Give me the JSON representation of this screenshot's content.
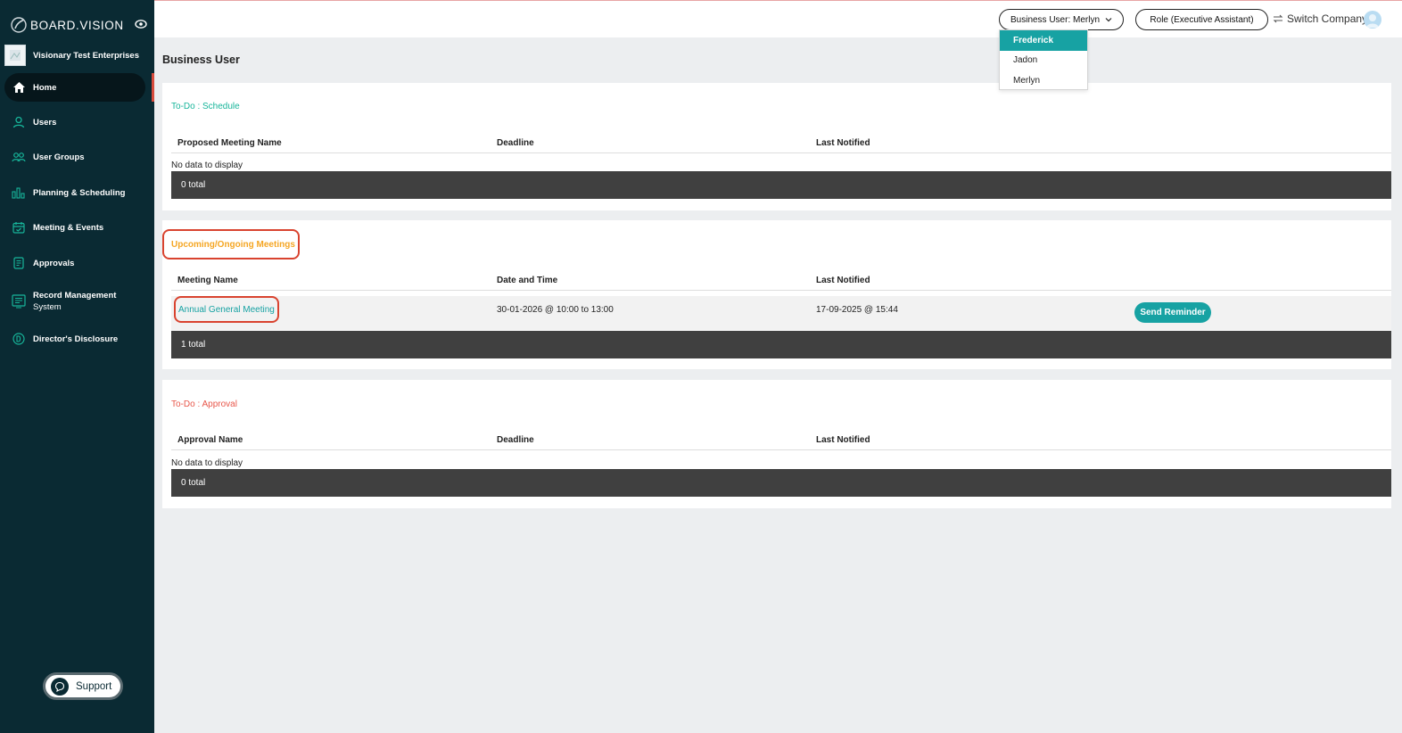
{
  "app": {
    "brand": "BOARD.VISION"
  },
  "sidebar": {
    "company": "Visionary Test Enterprises",
    "items": [
      {
        "label": "Home",
        "icon": "home-icon",
        "active": true
      },
      {
        "label": "Users",
        "icon": "user-icon"
      },
      {
        "label": "User Groups",
        "icon": "user-groups-icon"
      },
      {
        "label": "Planning & Scheduling",
        "icon": "bar-chart-icon"
      },
      {
        "label": "Meeting & Events",
        "icon": "calendar-icon"
      },
      {
        "label": "Approvals",
        "icon": "document-icon"
      },
      {
        "label_line1": "Record Management",
        "label_line2": "System",
        "icon": "records-icon"
      },
      {
        "label": "Director's Disclosure",
        "icon": "d-circle-icon"
      }
    ],
    "support_label": "Support"
  },
  "header": {
    "business_user": "Business User: Merlyn",
    "role": "Role (Executive Assistant)",
    "switch_company": "Switch Company",
    "dropdown_options": [
      "Frederick",
      "Jadon",
      "Merlyn"
    ],
    "dropdown_selected": "Frederick"
  },
  "page_title": "Business User",
  "schedule": {
    "title": "To-Do : Schedule",
    "columns": [
      "Proposed Meeting Name",
      "Deadline",
      "Last Notified"
    ],
    "empty_text": "No data to display",
    "total": "0 total"
  },
  "meetings": {
    "title": "Upcoming/Ongoing Meetings",
    "columns": [
      "Meeting Name",
      "Date and Time",
      "Last Notified"
    ],
    "rows": [
      {
        "name": "Annual General Meeting",
        "datetime": "30-01-2026 @ 10:00 to 13:00",
        "last_notified": "17-09-2025 @ 15:44",
        "action": "Send Reminder"
      }
    ],
    "total": "1 total"
  },
  "approval": {
    "title": "To-Do : Approval",
    "columns": [
      "Approval Name",
      "Deadline",
      "Last Notified"
    ],
    "empty_text": "No data to display",
    "total": "0 total"
  },
  "colors": {
    "sidebar_bg": "#0a2a33",
    "accent_teal": "#17a2a3",
    "schedule_title": "#17b59a",
    "meetings_title": "#f5a623",
    "approval_title": "#e8564a",
    "highlight_red": "#d9432f"
  }
}
